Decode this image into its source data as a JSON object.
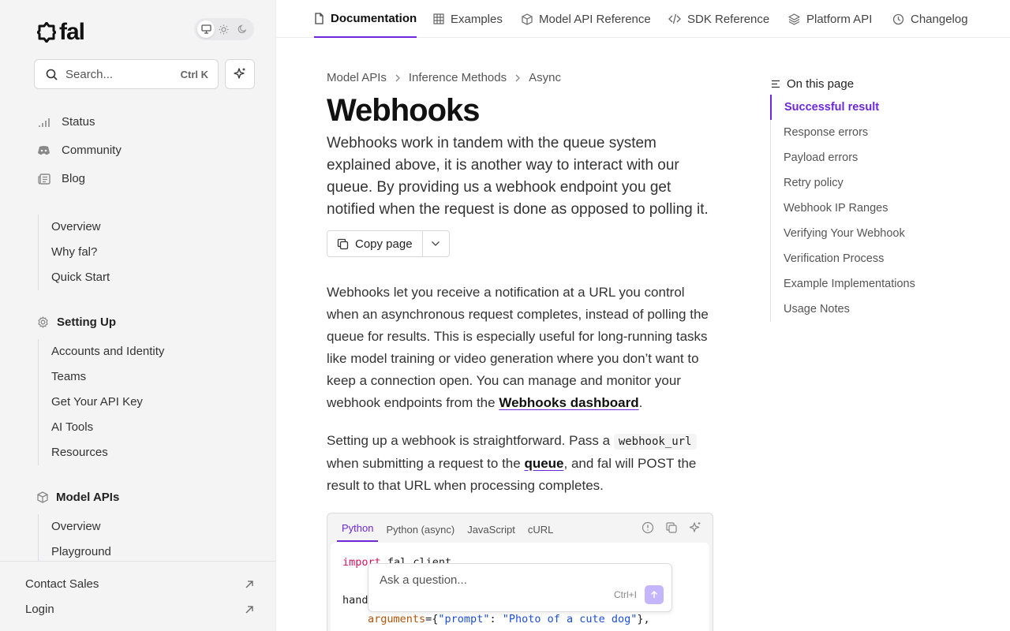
{
  "brand": {
    "name": "fal"
  },
  "sidebar": {
    "search": {
      "placeholder": "Search...",
      "shortcut": "Ctrl K"
    },
    "top_links": [
      {
        "label": "Status",
        "icon": "signal-icon"
      },
      {
        "label": "Community",
        "icon": "discord-icon"
      },
      {
        "label": "Blog",
        "icon": "newspaper-icon"
      }
    ],
    "intro": [
      "Overview",
      "Why fal?",
      "Quick Start"
    ],
    "setting_up": {
      "title": "Setting Up",
      "items": [
        "Accounts and Identity",
        "Teams",
        "Get Your API Key",
        "AI Tools",
        "Resources"
      ]
    },
    "model_apis": {
      "title": "Model APIs",
      "items": [
        "Overview",
        "Playground"
      ]
    },
    "bottom": {
      "contact": "Contact Sales",
      "login": "Login"
    }
  },
  "topnav": {
    "tabs": [
      {
        "label": "Documentation",
        "icon": "doc-icon"
      },
      {
        "label": "Examples",
        "icon": "grid-icon"
      },
      {
        "label": "Model API Reference",
        "icon": "cube-icon"
      },
      {
        "label": "SDK Reference",
        "icon": "code-icon"
      },
      {
        "label": "Platform API",
        "icon": "layers-icon"
      },
      {
        "label": "Changelog",
        "icon": "clock-icon"
      }
    ]
  },
  "page": {
    "breadcrumb": [
      "Model APIs",
      "Inference Methods",
      "Async"
    ],
    "title": "Webhooks",
    "lead": "Webhooks work in tandem with the queue system explained above, it is another way to interact with our queue. By providing us a webhook endpoint you get notified when the request is done as opposed to polling it.",
    "copy_label": "Copy page",
    "p1_text": "Webhooks let you receive a notification at a URL you control when an asynchronous request completes, instead of polling the queue for results. This is especially useful for long-running tasks like model training or video generation where you don’t want to keep a connection open. You can manage and monitor your webhook endpoints from the",
    "p1_link": "Webhooks dashboard",
    "p2_a": "Setting up a webhook is straightforward. Pass a",
    "p2_code": "webhook_url",
    "p2_b": "when submitting a request to the",
    "p2_link": "queue",
    "p2_c": ", and fal will POST the result to that URL when processing completes.",
    "code_tabs": [
      "Python",
      "Python (async)",
      "JavaScript",
      "cURL"
    ],
    "code": {
      "line1_kw": "import",
      "line1_rest": " fal_client",
      "line2": "hand",
      "line3_arg": "arguments",
      "line3_mid": "={",
      "line3_key": "\"prompt\"",
      "line3_colon": ": ",
      "line3_val": "\"Photo of a cute dog\"",
      "line3_end": "},"
    },
    "ask": {
      "placeholder": "Ask a question...",
      "shortcut": "Ctrl+I"
    }
  },
  "toc": {
    "title": "On this page",
    "items": [
      "Successful result",
      "Response errors",
      "Payload errors",
      "Retry policy",
      "Webhook IP Ranges",
      "Verifying Your Webhook",
      "Verification Process",
      "Example Implementations",
      "Usage Notes"
    ]
  },
  "colors": {
    "accent": "#6d28d9",
    "sidebar_bg": "#f4f4f5"
  }
}
